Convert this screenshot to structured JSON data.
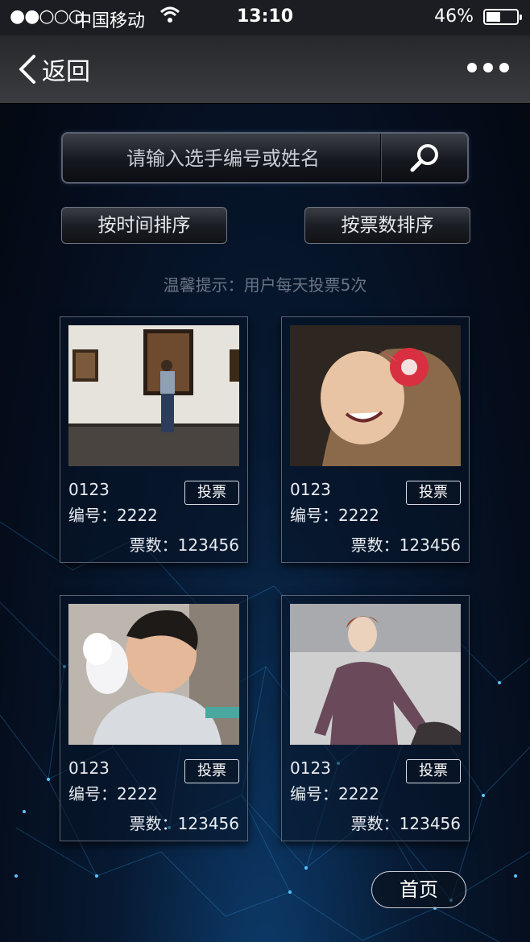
{
  "status_bar": {
    "signal": "●●○○○",
    "carrier": "中国移动",
    "time": "13:10",
    "battery": "46%"
  },
  "nav": {
    "back_label": "返回"
  },
  "search": {
    "placeholder": "请输入选手编号或姓名"
  },
  "sort": {
    "by_time": "按时间排序",
    "by_votes": "按票数排序"
  },
  "tip": "温馨提示：用户每天投票5次",
  "cards": [
    {
      "name": "0123",
      "number": "编号：2222",
      "vote_label": "投票",
      "votes": "票数：123456",
      "photo": "gallery-woman-photo"
    },
    {
      "name": "0123",
      "number": "编号：2222",
      "vote_label": "投票",
      "votes": "票数：123456",
      "photo": "girl-with-flower-photo"
    },
    {
      "name": "0123",
      "number": "编号：2222",
      "vote_label": "投票",
      "votes": "票数：123456",
      "photo": "boy-cotton-candy-photo"
    },
    {
      "name": "0123",
      "number": "编号：2222",
      "vote_label": "投票",
      "votes": "票数：123456",
      "photo": "fashion-model-photo"
    }
  ],
  "home_label": "首页"
}
